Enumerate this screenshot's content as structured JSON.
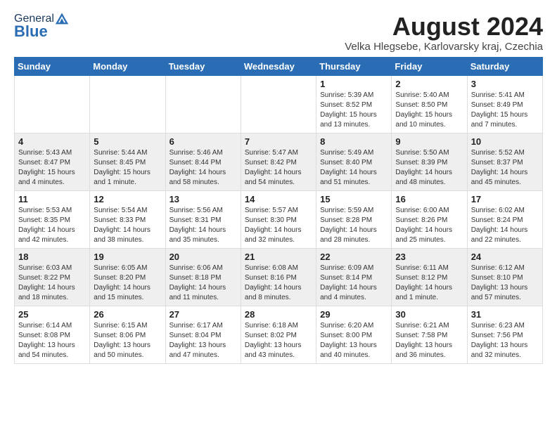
{
  "logo": {
    "general": "General",
    "blue": "Blue"
  },
  "title": "August 2024",
  "subtitle": "Velka Hlegsebe, Karlovarsky kraj, Czechia",
  "weekdays": [
    "Sunday",
    "Monday",
    "Tuesday",
    "Wednesday",
    "Thursday",
    "Friday",
    "Saturday"
  ],
  "weeks": [
    [
      {
        "day": "",
        "info": ""
      },
      {
        "day": "",
        "info": ""
      },
      {
        "day": "",
        "info": ""
      },
      {
        "day": "",
        "info": ""
      },
      {
        "day": "1",
        "info": "Sunrise: 5:39 AM\nSunset: 8:52 PM\nDaylight: 15 hours\nand 13 minutes."
      },
      {
        "day": "2",
        "info": "Sunrise: 5:40 AM\nSunset: 8:50 PM\nDaylight: 15 hours\nand 10 minutes."
      },
      {
        "day": "3",
        "info": "Sunrise: 5:41 AM\nSunset: 8:49 PM\nDaylight: 15 hours\nand 7 minutes."
      }
    ],
    [
      {
        "day": "4",
        "info": "Sunrise: 5:43 AM\nSunset: 8:47 PM\nDaylight: 15 hours\nand 4 minutes."
      },
      {
        "day": "5",
        "info": "Sunrise: 5:44 AM\nSunset: 8:45 PM\nDaylight: 15 hours\nand 1 minute."
      },
      {
        "day": "6",
        "info": "Sunrise: 5:46 AM\nSunset: 8:44 PM\nDaylight: 14 hours\nand 58 minutes."
      },
      {
        "day": "7",
        "info": "Sunrise: 5:47 AM\nSunset: 8:42 PM\nDaylight: 14 hours\nand 54 minutes."
      },
      {
        "day": "8",
        "info": "Sunrise: 5:49 AM\nSunset: 8:40 PM\nDaylight: 14 hours\nand 51 minutes."
      },
      {
        "day": "9",
        "info": "Sunrise: 5:50 AM\nSunset: 8:39 PM\nDaylight: 14 hours\nand 48 minutes."
      },
      {
        "day": "10",
        "info": "Sunrise: 5:52 AM\nSunset: 8:37 PM\nDaylight: 14 hours\nand 45 minutes."
      }
    ],
    [
      {
        "day": "11",
        "info": "Sunrise: 5:53 AM\nSunset: 8:35 PM\nDaylight: 14 hours\nand 42 minutes."
      },
      {
        "day": "12",
        "info": "Sunrise: 5:54 AM\nSunset: 8:33 PM\nDaylight: 14 hours\nand 38 minutes."
      },
      {
        "day": "13",
        "info": "Sunrise: 5:56 AM\nSunset: 8:31 PM\nDaylight: 14 hours\nand 35 minutes."
      },
      {
        "day": "14",
        "info": "Sunrise: 5:57 AM\nSunset: 8:30 PM\nDaylight: 14 hours\nand 32 minutes."
      },
      {
        "day": "15",
        "info": "Sunrise: 5:59 AM\nSunset: 8:28 PM\nDaylight: 14 hours\nand 28 minutes."
      },
      {
        "day": "16",
        "info": "Sunrise: 6:00 AM\nSunset: 8:26 PM\nDaylight: 14 hours\nand 25 minutes."
      },
      {
        "day": "17",
        "info": "Sunrise: 6:02 AM\nSunset: 8:24 PM\nDaylight: 14 hours\nand 22 minutes."
      }
    ],
    [
      {
        "day": "18",
        "info": "Sunrise: 6:03 AM\nSunset: 8:22 PM\nDaylight: 14 hours\nand 18 minutes."
      },
      {
        "day": "19",
        "info": "Sunrise: 6:05 AM\nSunset: 8:20 PM\nDaylight: 14 hours\nand 15 minutes."
      },
      {
        "day": "20",
        "info": "Sunrise: 6:06 AM\nSunset: 8:18 PM\nDaylight: 14 hours\nand 11 minutes."
      },
      {
        "day": "21",
        "info": "Sunrise: 6:08 AM\nSunset: 8:16 PM\nDaylight: 14 hours\nand 8 minutes."
      },
      {
        "day": "22",
        "info": "Sunrise: 6:09 AM\nSunset: 8:14 PM\nDaylight: 14 hours\nand 4 minutes."
      },
      {
        "day": "23",
        "info": "Sunrise: 6:11 AM\nSunset: 8:12 PM\nDaylight: 14 hours\nand 1 minute."
      },
      {
        "day": "24",
        "info": "Sunrise: 6:12 AM\nSunset: 8:10 PM\nDaylight: 13 hours\nand 57 minutes."
      }
    ],
    [
      {
        "day": "25",
        "info": "Sunrise: 6:14 AM\nSunset: 8:08 PM\nDaylight: 13 hours\nand 54 minutes."
      },
      {
        "day": "26",
        "info": "Sunrise: 6:15 AM\nSunset: 8:06 PM\nDaylight: 13 hours\nand 50 minutes."
      },
      {
        "day": "27",
        "info": "Sunrise: 6:17 AM\nSunset: 8:04 PM\nDaylight: 13 hours\nand 47 minutes."
      },
      {
        "day": "28",
        "info": "Sunrise: 6:18 AM\nSunset: 8:02 PM\nDaylight: 13 hours\nand 43 minutes."
      },
      {
        "day": "29",
        "info": "Sunrise: 6:20 AM\nSunset: 8:00 PM\nDaylight: 13 hours\nand 40 minutes."
      },
      {
        "day": "30",
        "info": "Sunrise: 6:21 AM\nSunset: 7:58 PM\nDaylight: 13 hours\nand 36 minutes."
      },
      {
        "day": "31",
        "info": "Sunrise: 6:23 AM\nSunset: 7:56 PM\nDaylight: 13 hours\nand 32 minutes."
      }
    ]
  ]
}
